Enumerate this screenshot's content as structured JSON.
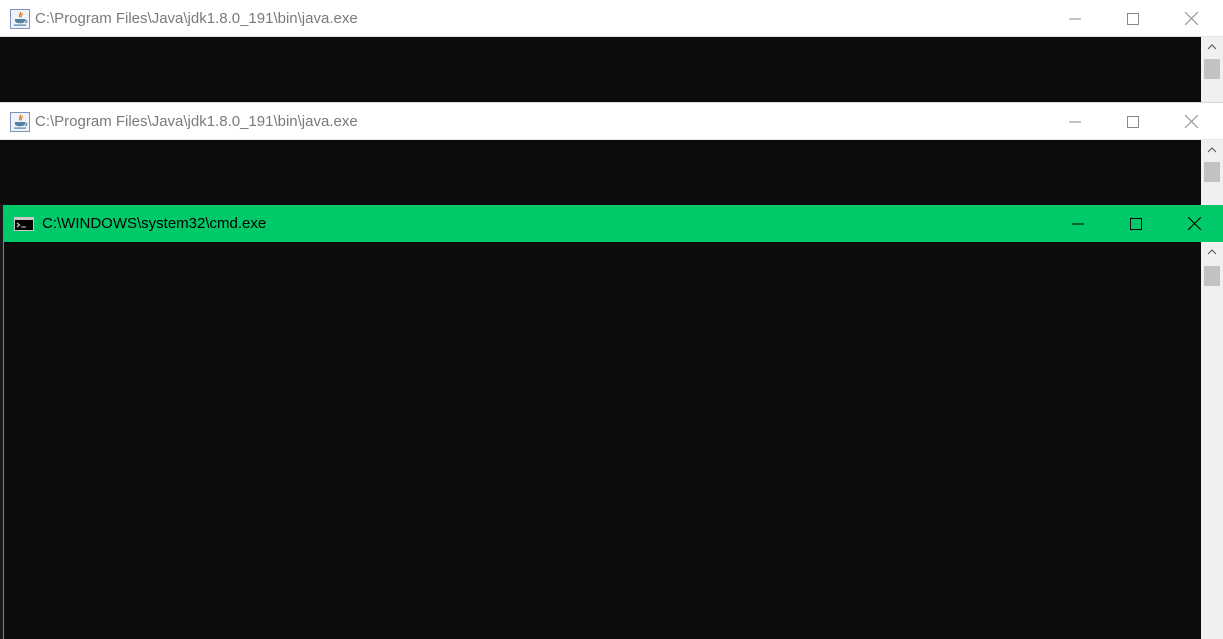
{
  "windows": [
    {
      "title": "C:\\Program Files\\Java\\jdk1.8.0_191\\bin\\java.exe",
      "icon": "java-icon",
      "controls": [
        "minimize",
        "maximize",
        "close"
      ]
    },
    {
      "title": "C:\\Program Files\\Java\\jdk1.8.0_191\\bin\\java.exe",
      "icon": "java-icon",
      "controls": [
        "minimize",
        "maximize",
        "close"
      ]
    },
    {
      "title": "C:\\WINDOWS\\system32\\cmd.exe",
      "icon": "cmd-icon",
      "controls": [
        "minimize",
        "maximize",
        "close"
      ],
      "active": true
    }
  ],
  "colors": {
    "active_titlebar": "#00c96a",
    "inactive_titlebar": "#ffffff",
    "console_bg": "#0c0c0c",
    "scrollbar_bg": "#f0f0f0"
  }
}
